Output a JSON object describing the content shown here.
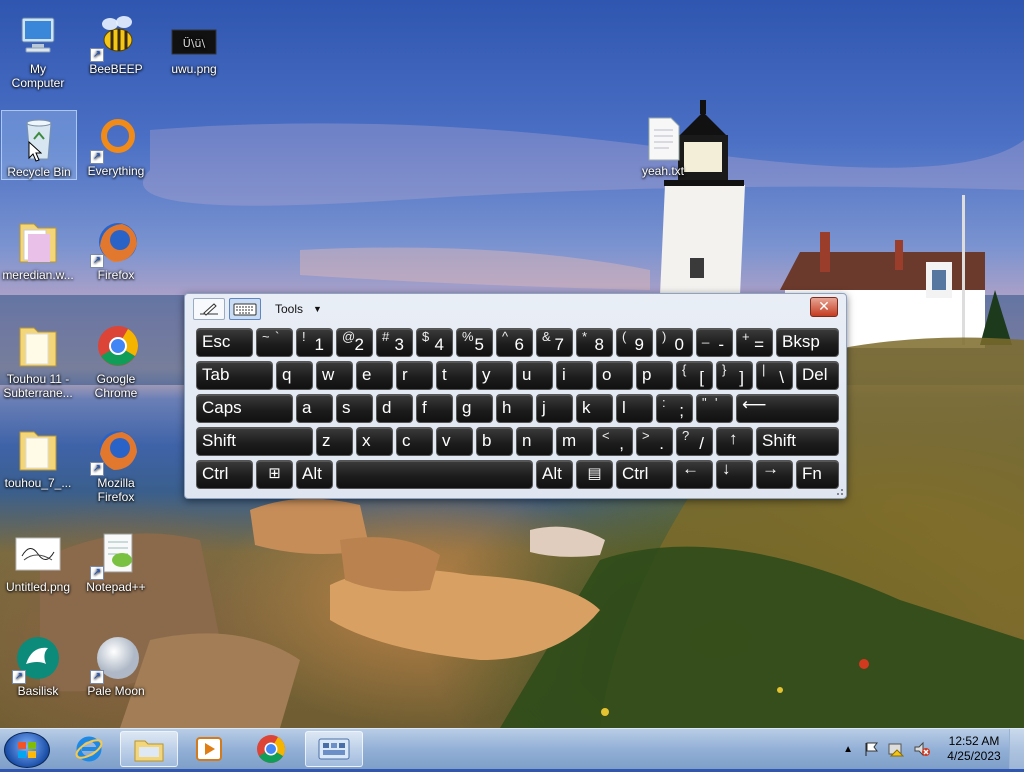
{
  "desktop": {
    "icons": [
      {
        "label": "My Computer",
        "icon": "computer-icon"
      },
      {
        "label": "BeeBEEP",
        "icon": "bee-icon"
      },
      {
        "label": "uwu.png",
        "icon": "image-file-icon"
      },
      {
        "label": "Recycle Bin",
        "icon": "recycle-bin-icon"
      },
      {
        "label": "Everything",
        "icon": "search-ring-icon"
      },
      {
        "label": "yeah.txt",
        "icon": "text-file-icon"
      },
      {
        "label": "meredian.w...",
        "icon": "folder-icon"
      },
      {
        "label": "Firefox",
        "icon": "firefox-icon"
      },
      {
        "label": "Touhou 11 - Subterrane...",
        "icon": "folder-icon"
      },
      {
        "label": "Google Chrome",
        "icon": "chrome-icon"
      },
      {
        "label": "touhou_7_...",
        "icon": "folder-icon"
      },
      {
        "label": "Mozilla Firefox",
        "icon": "firefox-icon"
      },
      {
        "label": "Untitled.png",
        "icon": "image-file-icon"
      },
      {
        "label": "Notepad++",
        "icon": "notepadpp-icon"
      },
      {
        "label": "Basilisk",
        "icon": "basilisk-icon"
      },
      {
        "label": "Pale Moon",
        "icon": "palemoon-icon"
      }
    ],
    "thumbnail_text": "Ü\\ü\\"
  },
  "osk": {
    "tools_label": "Tools",
    "close_label": "✕",
    "keys": {
      "esc": "Esc",
      "tilde_top": "~",
      "tilde_bot": "`",
      "n1_top": "!",
      "n1": "1",
      "n2_top": "@",
      "n2": "2",
      "n3_top": "#",
      "n3": "3",
      "n4_top": "$",
      "n4": "4",
      "n5_top": "%",
      "n5": "5",
      "n6_top": "^",
      "n6": "6",
      "n7_top": "&",
      "n7": "7",
      "n8_top": "*",
      "n8": "8",
      "n9_top": "(",
      "n9": "9",
      "n0_top": ")",
      "n0": "0",
      "minus_top": "_",
      "minus": "-",
      "plus_top": "+",
      "equals": "=",
      "bksp": "Bksp",
      "tab": "Tab",
      "q": "q",
      "w": "w",
      "e": "e",
      "r": "r",
      "t": "t",
      "y": "y",
      "u": "u",
      "i": "i",
      "o": "o",
      "p": "p",
      "lbrace": "{",
      "lbracket": "[",
      "rbrace": "}",
      "rbracket": "]",
      "pipe": "|",
      "backslash": "\\",
      "del": "Del",
      "caps": "Caps",
      "a": "a",
      "s": "s",
      "d": "d",
      "f": "f",
      "g": "g",
      "h": "h",
      "j": "j",
      "k": "k",
      "l": "l",
      "colon": ":",
      "semicolon": ";",
      "quote_top": "\"",
      "quote": "'",
      "enter": "⟵",
      "shift": "Shift",
      "z": "z",
      "x": "x",
      "c": "c",
      "v": "v",
      "b": "b",
      "n": "n",
      "m": "m",
      "lt": "<",
      "comma": ",",
      "gt": ">",
      "period": ".",
      "question": "?",
      "slash": "/",
      "up": "↑",
      "shift_r": "Shift",
      "ctrl": "Ctrl",
      "win": "⊞",
      "alt": "Alt",
      "alt_r": "Alt",
      "menu": "▤",
      "ctrl_r": "Ctrl",
      "left": "←",
      "down": "↓",
      "right": "→",
      "fn": "Fn"
    }
  },
  "taskbar": {
    "items": [
      "start-button",
      "internet-explorer-icon",
      "file-explorer-icon",
      "media-player-icon",
      "chrome-icon",
      "on-screen-keyboard-icon"
    ],
    "time": "12:52 AM",
    "date": "4/25/2023"
  },
  "colors": {
    "osk_key": "#1b1b1b",
    "taskbar": "#93b0d6",
    "close": "#c43c21"
  }
}
